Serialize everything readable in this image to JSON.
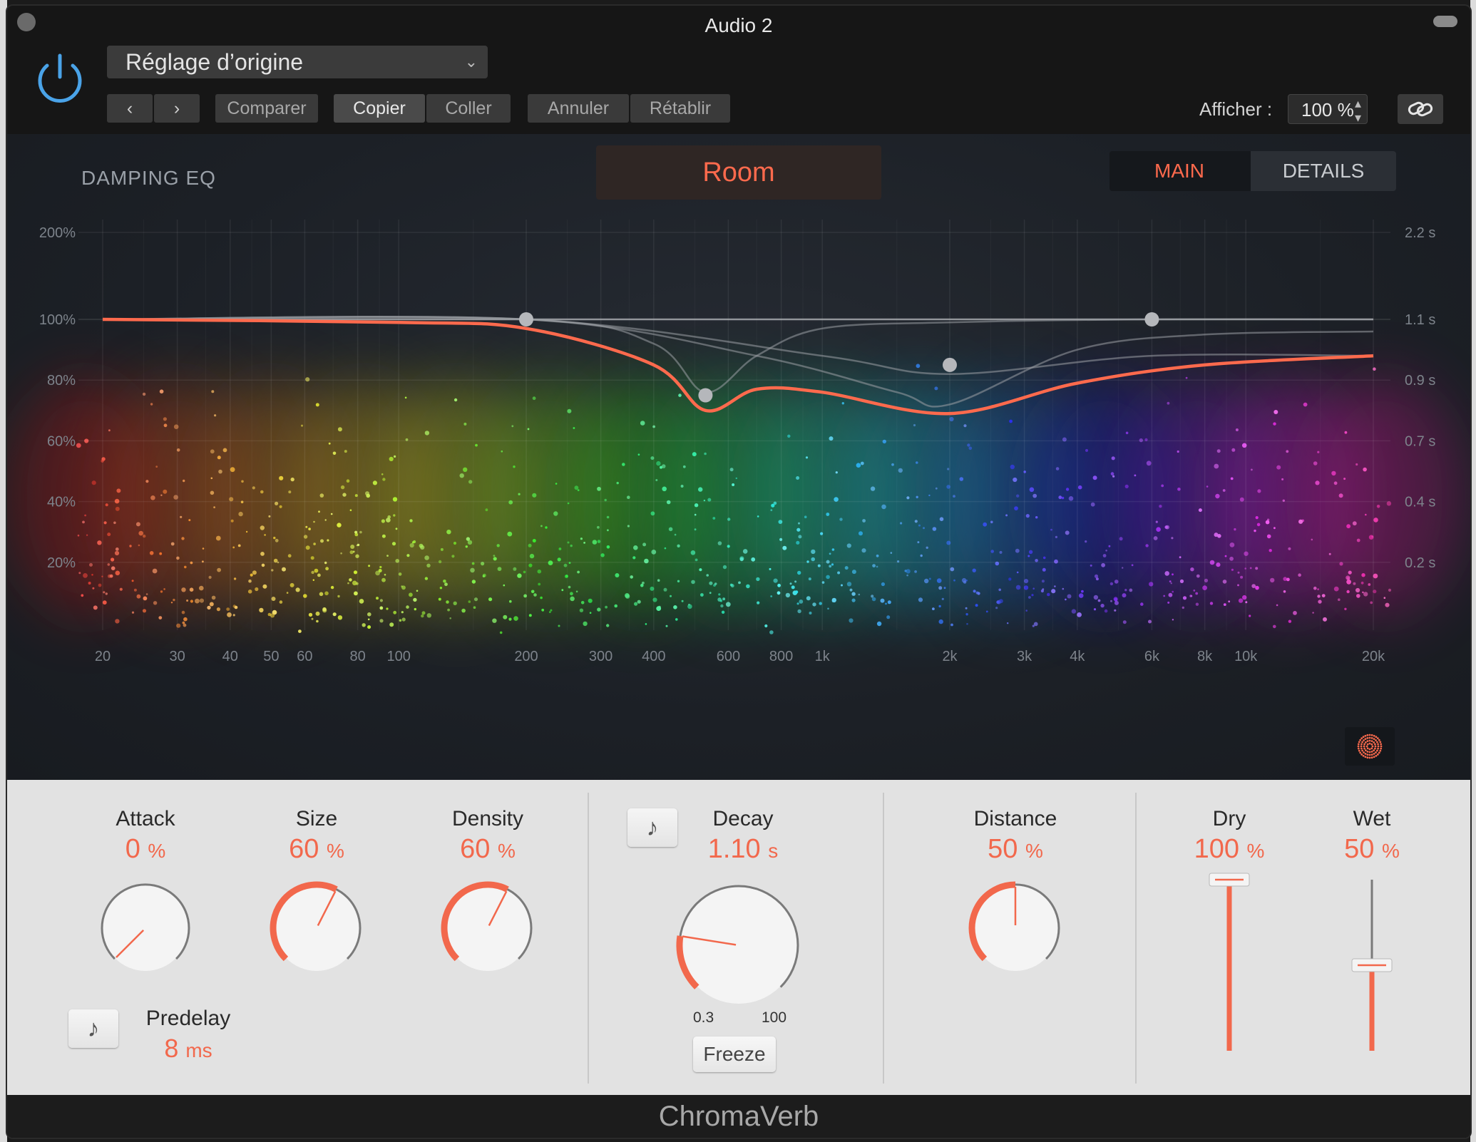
{
  "window": {
    "title": "Audio 2"
  },
  "header": {
    "preset": "Réglage d’origine",
    "compare": "Comparer",
    "copy": "Copier",
    "paste": "Coller",
    "undo": "Annuler",
    "redo": "Rétablir",
    "show_label": "Afficher :",
    "zoom": "100 %"
  },
  "display": {
    "damping_label": "DAMPING EQ",
    "room_type": "Room",
    "tab_main": "MAIN",
    "tab_details": "DETAILS"
  },
  "chart_data": {
    "type": "line",
    "x_scale": "log",
    "x_ticks": [
      "20",
      "30",
      "40",
      "50",
      "60",
      "80",
      "100",
      "200",
      "300",
      "400",
      "600",
      "800",
      "1k",
      "2k",
      "3k",
      "4k",
      "6k",
      "8k",
      "10k",
      "20k"
    ],
    "y_left_ticks": [
      "200%",
      "100%",
      "80%",
      "60%",
      "40%",
      "20%"
    ],
    "y_right_ticks": [
      "2.2 s",
      "1.1 s",
      "0.9 s",
      "0.7 s",
      "0.4 s",
      "0.2 s"
    ],
    "series": [
      {
        "x": [
          20,
          100,
          200,
          400,
          530,
          700,
          1000,
          2000,
          4000,
          8000,
          20000
        ],
        "values": [
          100,
          99,
          97,
          85,
          70,
          77,
          76,
          69,
          79,
          85,
          88
        ]
      }
    ],
    "handles": [
      {
        "x": 200,
        "y": 100
      },
      {
        "x": 530,
        "y": 75
      },
      {
        "x": 2000,
        "y": 85
      },
      {
        "x": 6000,
        "y": 100
      }
    ],
    "curve_color": "#ff6a4d"
  },
  "controls": {
    "attack": {
      "label": "Attack",
      "value": "0",
      "unit": "%",
      "fraction": 0.0
    },
    "size": {
      "label": "Size",
      "value": "60",
      "unit": "%",
      "fraction": 0.6
    },
    "density": {
      "label": "Density",
      "value": "60",
      "unit": "%",
      "fraction": 0.6
    },
    "predelay": {
      "label": "Predelay",
      "value": "8",
      "unit": "ms"
    },
    "decay": {
      "label": "Decay",
      "value": "1.10",
      "unit": "s",
      "fraction": 0.2,
      "min_label": "0.3",
      "max_label": "100"
    },
    "freeze": "Freeze",
    "distance": {
      "label": "Distance",
      "value": "50",
      "unit": "%",
      "fraction": 0.5
    },
    "dry": {
      "label": "Dry",
      "value": "100",
      "unit": "%",
      "fraction": 1.0
    },
    "wet": {
      "label": "Wet",
      "value": "50",
      "unit": "%",
      "fraction": 0.5
    }
  },
  "footer": {
    "plugin_name": "ChromaVerb"
  },
  "colors": {
    "accent": "#f2684c",
    "panel": "#e2e2e2",
    "display": "#1c2026"
  }
}
